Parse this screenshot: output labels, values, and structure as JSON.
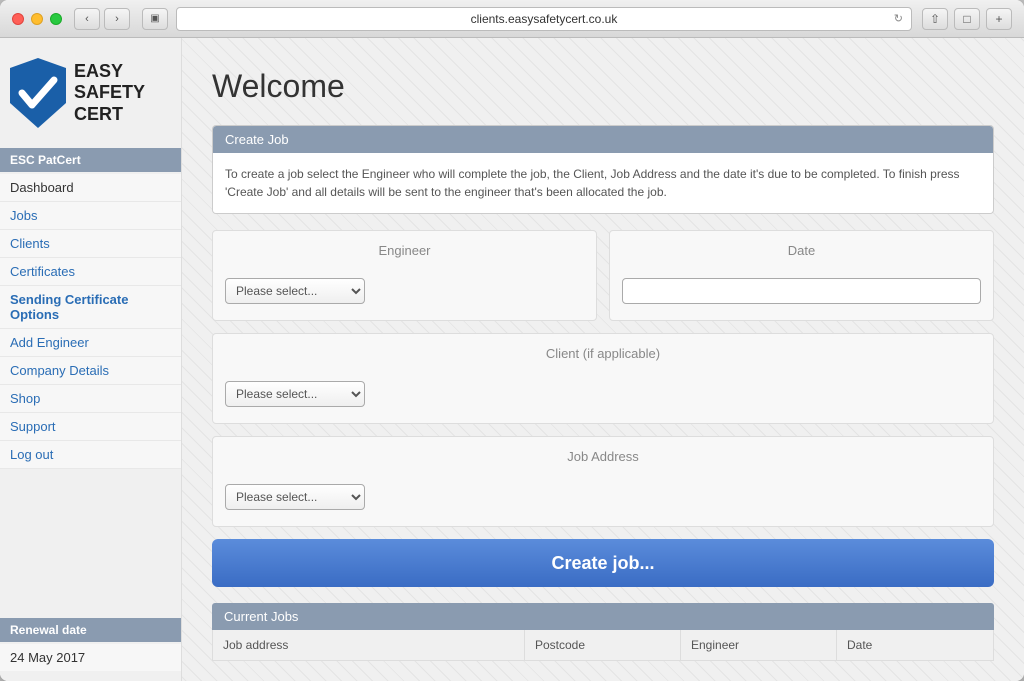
{
  "browser": {
    "url": "clients.easysafetycert.co.uk"
  },
  "logo": {
    "line1": "EASY",
    "line2": "SAFETY",
    "line3": "CERT"
  },
  "sidebar": {
    "section_label": "ESC PatCert",
    "items": [
      {
        "id": "dashboard",
        "label": "Dashboard",
        "color": "dark"
      },
      {
        "id": "jobs",
        "label": "Jobs",
        "color": "blue"
      },
      {
        "id": "clients",
        "label": "Clients",
        "color": "blue"
      },
      {
        "id": "certificates",
        "label": "Certificates",
        "color": "blue"
      },
      {
        "id": "sending-cert-options",
        "label": "Sending Certificate Options",
        "color": "blue",
        "bold": true
      },
      {
        "id": "add-engineer",
        "label": "Add Engineer",
        "color": "blue"
      },
      {
        "id": "company-details",
        "label": "Company Details",
        "color": "blue"
      },
      {
        "id": "shop",
        "label": "Shop",
        "color": "blue"
      },
      {
        "id": "support",
        "label": "Support",
        "color": "blue"
      },
      {
        "id": "log-out",
        "label": "Log out",
        "color": "blue"
      }
    ],
    "renewal": {
      "header": "Renewal date",
      "date": "24 May 2017"
    }
  },
  "main": {
    "title": "Welcome",
    "create_job": {
      "header": "Create Job",
      "description": "To create a job select the Engineer who will complete the job, the Client, Job Address and the date it's due to be completed. To finish press 'Create Job' and all details will be sent to the engineer that's been allocated the job.",
      "engineer_label": "Engineer",
      "date_label": "Date",
      "client_label": "Client (if applicable)",
      "job_address_label": "Job Address",
      "select_placeholder": "Please select...",
      "create_btn": "Create job...",
      "current_jobs_header": "Current Jobs",
      "table_headers": [
        "Job address",
        "Postcode",
        "Engineer",
        "Date"
      ]
    }
  }
}
